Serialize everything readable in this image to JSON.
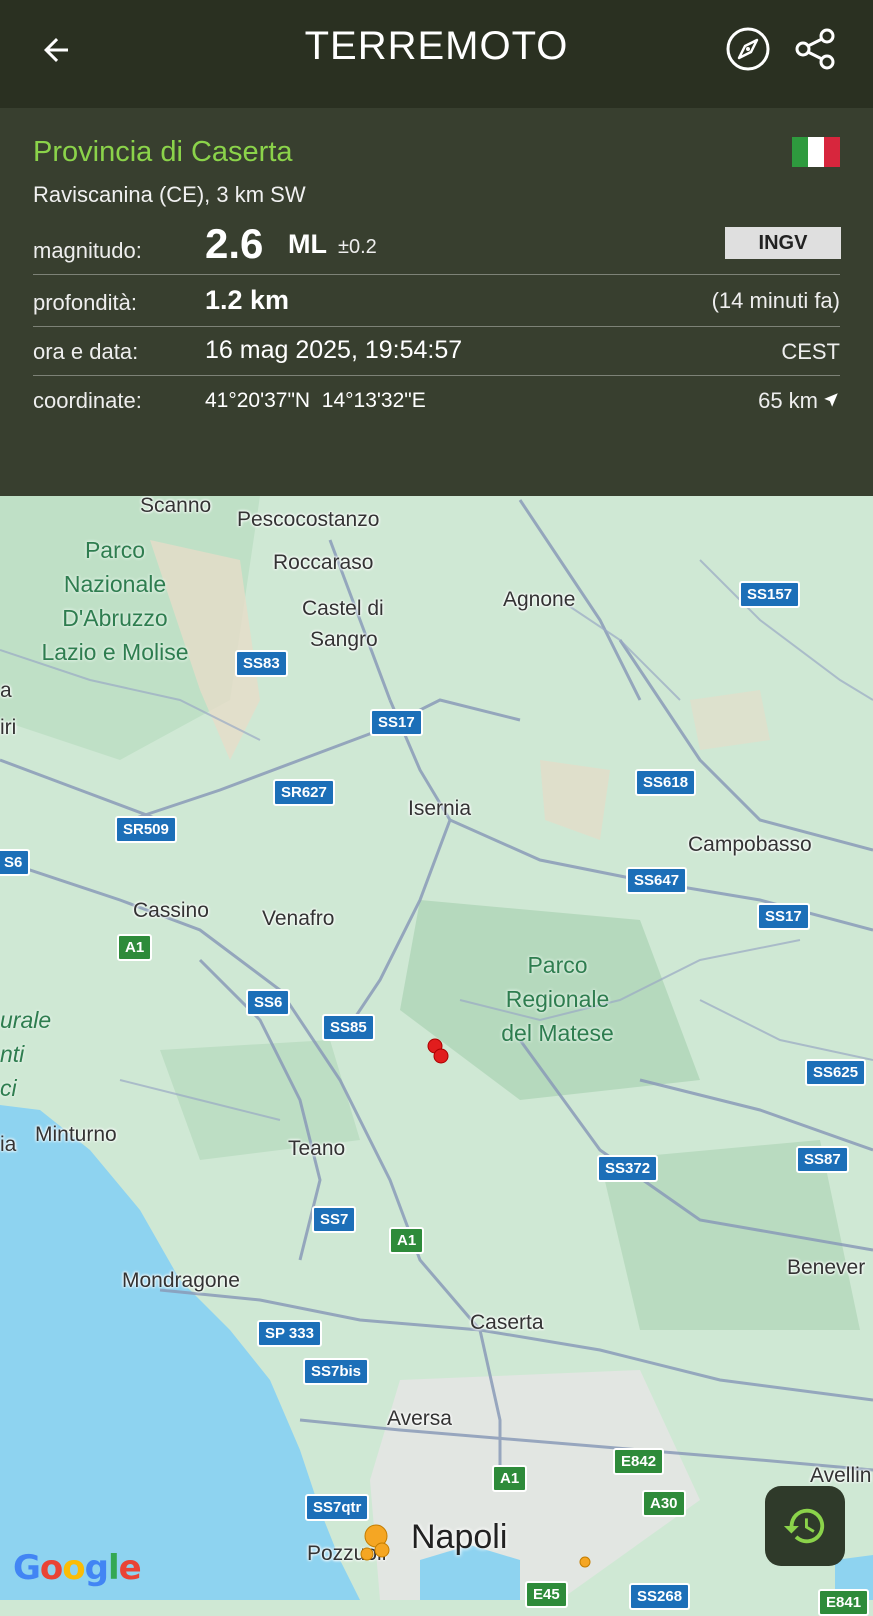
{
  "header": {
    "title": "TERREMOTO",
    "back_icon": "arrow-left-icon",
    "compass_icon": "compass-icon",
    "share_icon": "share-icon"
  },
  "event": {
    "province": "Provincia di Caserta",
    "locality": "Raviscanina (CE), 3 km SW",
    "country_flag": "italy-flag-icon",
    "magnitude_label": "magnitudo:",
    "magnitude_value": "2.6",
    "magnitude_unit": "ML",
    "magnitude_error": "±0.2",
    "agency": "INGV",
    "depth_label": "profondità:",
    "depth_value": "1.2 km",
    "elapsed": "(14 minuti fa)",
    "datetime_label": "ora e data:",
    "datetime_value": "16 mag 2025, 19:54:57",
    "timezone": "CEST",
    "coords_label": "coordinate:",
    "coords_value": "41°20'37\"N  14°13'32\"E",
    "distance": "65 km"
  },
  "map": {
    "places": [
      "Scanno",
      "Pescocostanzo",
      "Roccaraso",
      "Castel di",
      "Sangro",
      "Agnone",
      "Isernia",
      "Campobasso",
      "Cassino",
      "Venafro",
      "Minturno",
      "Teano",
      "Mondragone",
      "Caserta",
      "Aversa",
      "Pozzuoli",
      "Benever",
      "Avellin",
      "iri",
      "a",
      "ia"
    ],
    "big_city": "Napoli",
    "parks": [
      {
        "lines": [
          "Parco",
          "Nazionale",
          "D'Abruzzo",
          "Lazio e Molise"
        ]
      },
      {
        "lines": [
          "Parco",
          "Regionale",
          "del Matese"
        ]
      }
    ],
    "partial_park_left": [
      "urale",
      "nti",
      "ci"
    ],
    "roads": [
      "SS157",
      "SS83",
      "SS17",
      "SR627",
      "SS618",
      "SR509",
      "S6",
      "SS647",
      "SS17",
      "A1",
      "SS6",
      "SS85",
      "SS625",
      "SS372",
      "SS87",
      "SS7",
      "A1",
      "SP 333",
      "SS7bis",
      "E842",
      "A1",
      "A30",
      "SS7qtr",
      "E45",
      "SS268",
      "E841"
    ],
    "attribution": "Google"
  },
  "colors": {
    "header_bg": "#2a3021",
    "province_green": "#8bd34a",
    "quake_red": "#e11d1d",
    "quake_orange": "#f5a623",
    "sea": "#8ed3f0",
    "land": "#cfe8d4"
  }
}
